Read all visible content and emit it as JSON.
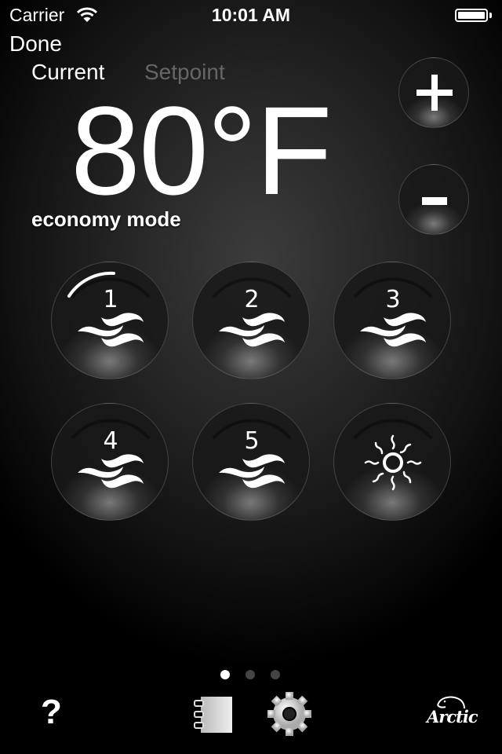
{
  "status_bar": {
    "carrier": "Carrier",
    "wifi_icon": "wifi-icon",
    "time": "10:01 AM",
    "battery_icon": "battery-icon"
  },
  "nav": {
    "done_label": "Done"
  },
  "tabs": [
    {
      "label": "Current",
      "active": true
    },
    {
      "label": "Setpoint",
      "active": false
    }
  ],
  "temperature": {
    "value": "80°F"
  },
  "mode": {
    "label": "economy mode"
  },
  "controls": {
    "increase_icon": "plus-icon",
    "decrease_icon": "minus-icon"
  },
  "fan_buttons": [
    {
      "label": "1",
      "icon": "fan-waves-icon",
      "active": true,
      "level": 0.25
    },
    {
      "label": "2",
      "icon": "fan-waves-icon",
      "active": false
    },
    {
      "label": "3",
      "icon": "fan-waves-icon",
      "active": false
    },
    {
      "label": "4",
      "icon": "fan-waves-icon",
      "active": false
    },
    {
      "label": "5",
      "icon": "fan-waves-icon",
      "active": false
    },
    {
      "label": "",
      "icon": "sun-icon",
      "active": false
    }
  ],
  "page_indicator": {
    "pages": 3,
    "current": 1
  },
  "toolbar": {
    "help_label": "?",
    "notebook_icon": "notebook-icon",
    "settings_icon": "gear-icon",
    "brand": "Arctic",
    "brand_icon": "polar-bear-logo-icon"
  }
}
